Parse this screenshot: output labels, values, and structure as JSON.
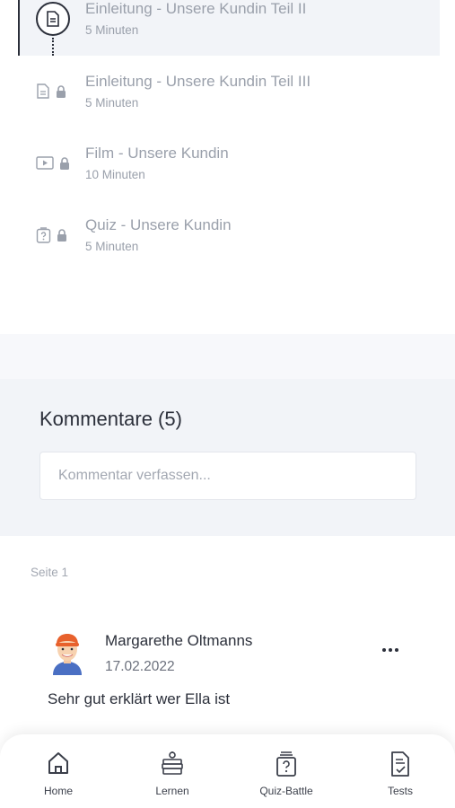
{
  "lessons": [
    {
      "title": "Einleitung - Unsere Kundin Teil II",
      "duration": "5 Minuten",
      "type": "document",
      "locked": false,
      "active": true
    },
    {
      "title": "Einleitung - Unsere Kundin Teil III",
      "duration": "5 Minuten",
      "type": "document",
      "locked": true,
      "active": false
    },
    {
      "title": "Film - Unsere Kundin",
      "duration": "10 Minuten",
      "type": "video",
      "locked": true,
      "active": false
    },
    {
      "title": "Quiz - Unsere Kundin",
      "duration": "5 Minuten",
      "type": "quiz",
      "locked": true,
      "active": false
    }
  ],
  "comments_section": {
    "title": "Kommentare (5)",
    "input_placeholder": "Kommentar verfassen...",
    "input_value": ""
  },
  "pagination": {
    "label": "Seite 1"
  },
  "comments": [
    {
      "author": "Margarethe Oltmanns",
      "date": "17.02.2022",
      "text": "Sehr gut erklärt wer Ella ist",
      "avatar_icon": "user-avatar"
    }
  ],
  "bottom_nav": [
    {
      "label": "Home",
      "icon": "home-icon"
    },
    {
      "label": "Lernen",
      "icon": "books-icon"
    },
    {
      "label": "Quiz-Battle",
      "icon": "quiz-icon"
    },
    {
      "label": "Tests",
      "icon": "test-document-icon"
    }
  ],
  "colors": {
    "text_dark": "#2b2f3a",
    "text_muted": "#9aa0ab",
    "panel_bg": "#f2f4f8"
  }
}
